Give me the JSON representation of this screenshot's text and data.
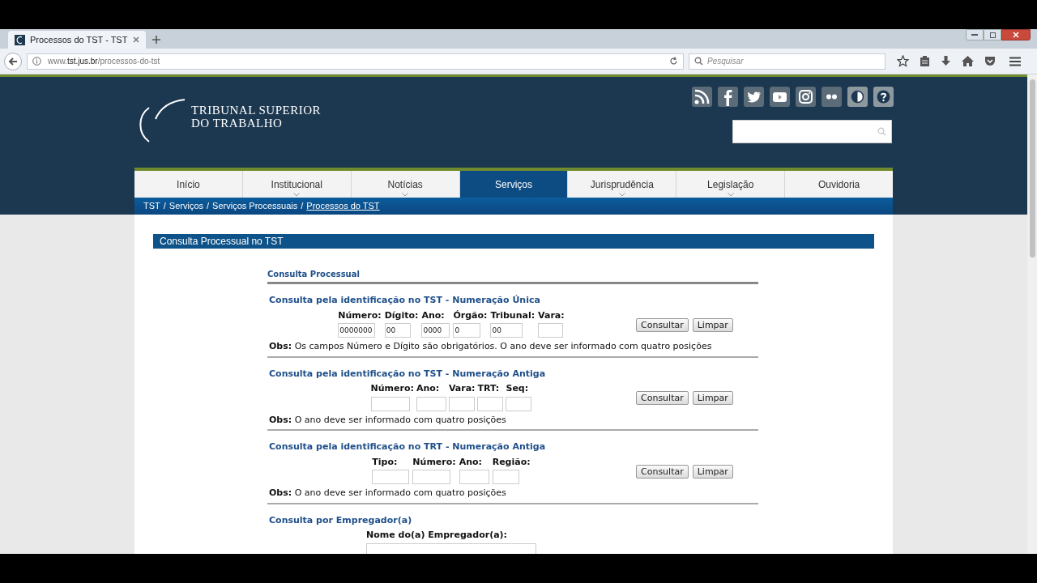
{
  "browser": {
    "tab_title": "Processos do TST - TST",
    "url_prefix": "www.",
    "url_domain": "tst.jus.br",
    "url_path": "/processos-do-tst",
    "search_placeholder": "Pesquisar"
  },
  "header": {
    "logo_lines": [
      "TRIBUNAL SUPERIOR",
      "DO TRABALHO"
    ]
  },
  "nav": [
    {
      "label": "Início",
      "selected": false,
      "submenu": false
    },
    {
      "label": "Institucional",
      "selected": false,
      "submenu": true
    },
    {
      "label": "Notícias",
      "selected": false,
      "submenu": true
    },
    {
      "label": "Serviços",
      "selected": true,
      "submenu": false
    },
    {
      "label": "Jurisprudência",
      "selected": false,
      "submenu": true
    },
    {
      "label": "Legislação",
      "selected": false,
      "submenu": true
    },
    {
      "label": "Ouvidoria",
      "selected": false,
      "submenu": false
    }
  ],
  "breadcrumb": [
    {
      "label": "TST",
      "current": false
    },
    {
      "separator": "/",
      "label": "Serviços",
      "current": false
    },
    {
      "separator": "/",
      "label": "Serviços Processuais",
      "current": false
    },
    {
      "separator": "/",
      "label": "Processos do TST",
      "current": true
    }
  ],
  "panel_title": "Consulta Processual no TST",
  "form_title": "Consulta Processual",
  "sections": [
    {
      "title": "Consulta pela identificação no TST - Numeração Única",
      "fields": [
        {
          "label": "Número:",
          "value": "0000000"
        },
        {
          "label": "Dígito:",
          "value": "00"
        },
        {
          "label": "Ano:",
          "value": "0000"
        },
        {
          "label": "Órgão:",
          "value": "0"
        },
        {
          "label": "Tribunal:",
          "value": "00"
        },
        {
          "label": "Vara:"
        }
      ],
      "buttons": [
        "Consultar",
        "Limpar"
      ],
      "obs_label": "Obs:",
      "obs_text": "Os campos Número e Dígito são obrigatórios. O ano deve ser informado com quatro posições"
    },
    {
      "title": "Consulta pela identificação no TST - Numeração Antiga",
      "fields": [
        {
          "label": "Número:"
        },
        {
          "label": "Ano:"
        },
        {
          "label": "Vara:"
        },
        {
          "label": "TRT:"
        },
        {
          "label": "Seq:"
        }
      ],
      "buttons": [
        "Consultar",
        "Limpar"
      ],
      "obs_label": "Obs:",
      "obs_text": "O ano deve ser informado com quatro posições"
    },
    {
      "title": "Consulta pela identificação no TRT - Numeração Antiga",
      "fields": [
        {
          "label": "Tipo:"
        },
        {
          "label": "Número:"
        },
        {
          "label": "Ano:"
        },
        {
          "label": "Região:"
        }
      ],
      "buttons": [
        "Consultar",
        "Limpar"
      ],
      "obs_label": "Obs:",
      "obs_text": "O ano deve ser informado com quatro posições"
    },
    {
      "title": "Consulta por Empregador(a)",
      "fields": [
        {
          "label": "Nome do(a) Empregador(a):"
        }
      ]
    }
  ]
}
